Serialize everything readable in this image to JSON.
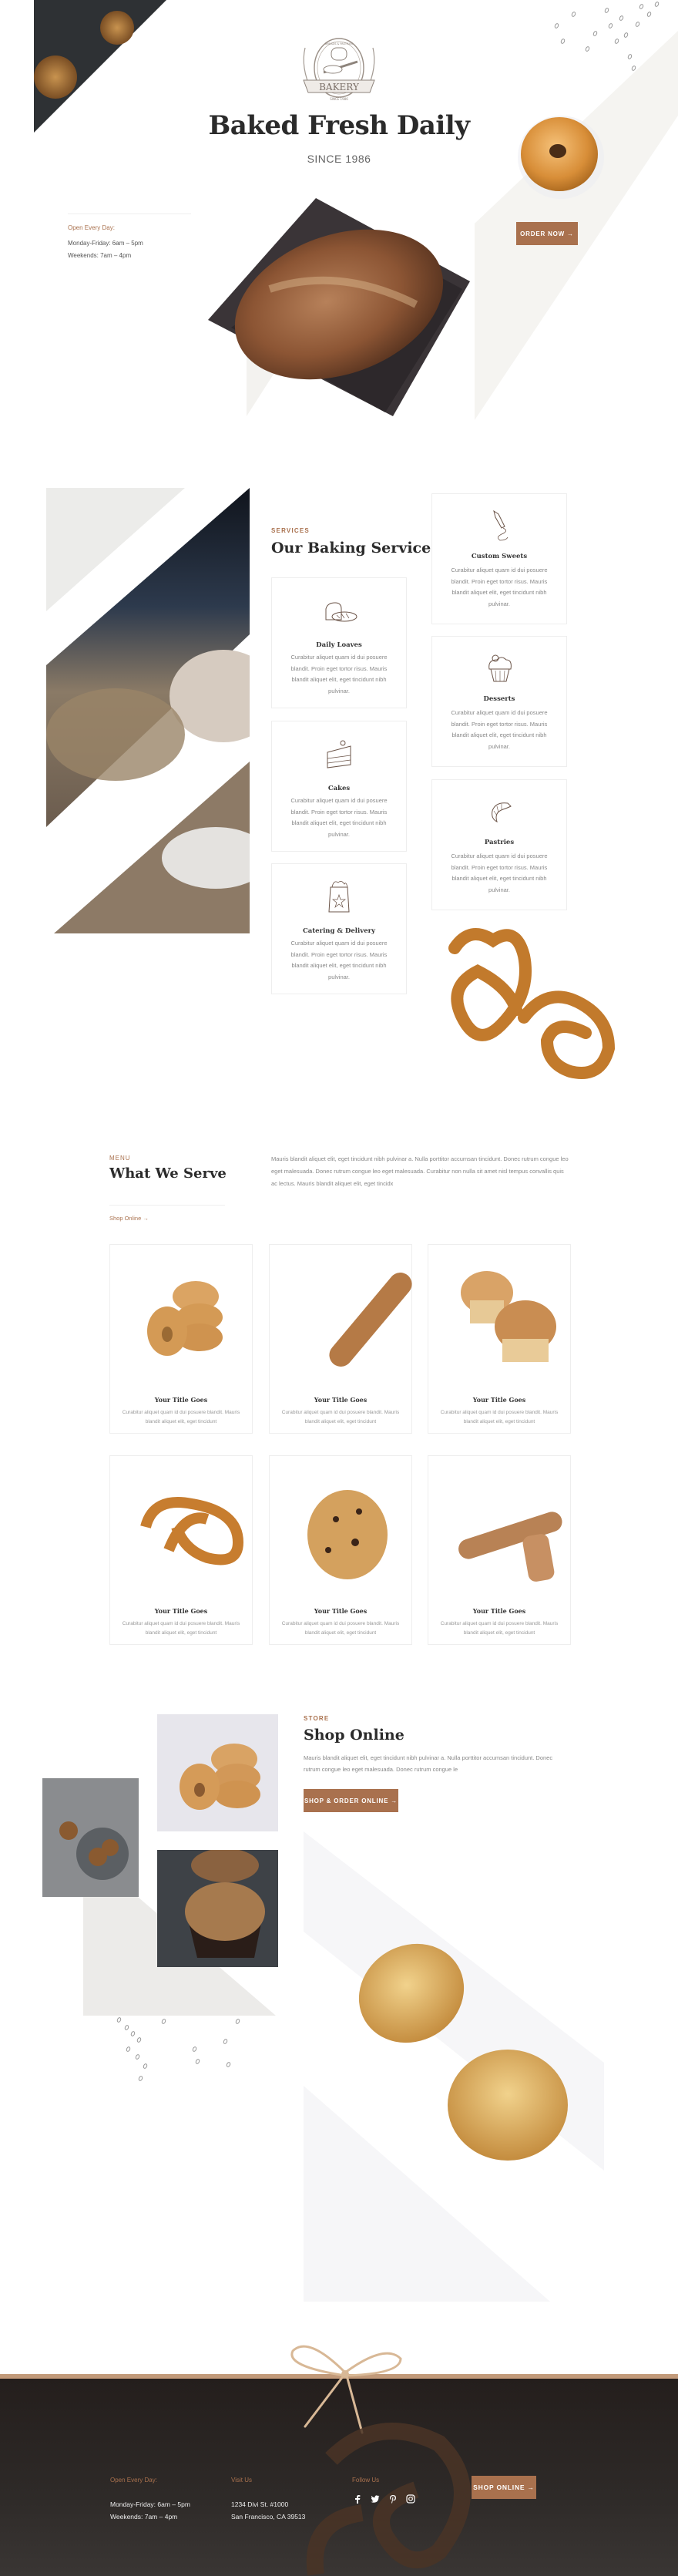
{
  "colors": {
    "accent": "#a9714e",
    "heading": "#2b2b2b",
    "body": "#888888",
    "light_panel": "#f5f4f1",
    "footer_bg": "#2a2624"
  },
  "hero": {
    "logo": {
      "name": "BAKERY",
      "arc_text": "BREADS & PASTRIES",
      "since": "SINCE 1986"
    },
    "title": "Baked Fresh Daily",
    "subtitle": "SINCE 1986",
    "hours": {
      "label": "Open Every Day:",
      "weekdays": "Monday-Friday: 6am – 5pm",
      "weekends": "Weekends: 7am – 4pm"
    },
    "order_button": "ORDER NOW →"
  },
  "services": {
    "eyebrow": "SERVICES",
    "title": "Our Baking Services",
    "items": [
      {
        "icon": "bread-loaf-icon",
        "title": "Daily Loaves",
        "desc": "Curabitur aliquet quam id dui posuere blandit. Proin eget tortor risus. Mauris blandit aliquet elit, eget tincidunt nibh pulvinar."
      },
      {
        "icon": "cake-slice-icon",
        "title": "Cakes",
        "desc": "Curabitur aliquet quam id dui posuere blandit. Proin eget tortor risus. Mauris blandit aliquet elit, eget tincidunt nibh pulvinar."
      },
      {
        "icon": "grocery-bag-icon",
        "title": "Catering & Delivery",
        "desc": "Curabitur aliquet quam id dui posuere blandit. Proin eget tortor risus. Mauris blandit aliquet elit, eget tincidunt nibh pulvinar."
      },
      {
        "icon": "piping-bag-icon",
        "title": "Custom Sweets",
        "desc": "Curabitur aliquet quam id dui posuere blandit. Proin eget tortor risus. Mauris blandit aliquet elit, eget tincidunt nibh pulvinar."
      },
      {
        "icon": "cupcake-icon",
        "title": "Desserts",
        "desc": "Curabitur aliquet quam id dui posuere blandit. Proin eget tortor risus. Mauris blandit aliquet elit, eget tincidunt nibh pulvinar."
      },
      {
        "icon": "croissant-icon",
        "title": "Pastries",
        "desc": "Curabitur aliquet quam id dui posuere blandit. Proin eget tortor risus. Mauris blandit aliquet elit, eget tincidunt nibh pulvinar."
      }
    ]
  },
  "menu": {
    "eyebrow": "MENU",
    "title": "What We Serve",
    "intro": "Mauris blandit aliquet elit, eget tincidunt nibh pulvinar a. Nulla porttitor accumsan tincidunt. Donec rutrum congue leo eget malesuada. Donec rutrum congue leo eget malesuada. Curabitur non nulla sit amet nisl tempus convallis quis ac lectus. Mauris blandit aliquet elit, eget tincidx",
    "link": "Shop Online →",
    "items": [
      {
        "image": "bagels",
        "title": "Your Title Goes",
        "desc": "Curabitur aliquet quam id dui posuere blandit. Mauris blandit aliquet elit, eget tincidunt"
      },
      {
        "image": "baguette",
        "title": "Your Title Goes",
        "desc": "Curabitur aliquet quam id dui posuere blandit. Mauris blandit aliquet elit, eget tincidunt"
      },
      {
        "image": "muffins",
        "title": "Your Title Goes",
        "desc": "Curabitur aliquet quam id dui posuere blandit. Mauris blandit aliquet elit, eget tincidunt"
      },
      {
        "image": "pretzel",
        "title": "Your Title Goes",
        "desc": "Curabitur aliquet quam id dui posuere blandit. Mauris blandit aliquet elit, eget tincidunt"
      },
      {
        "image": "cookie",
        "title": "Your Title Goes",
        "desc": "Curabitur aliquet quam id dui posuere blandit. Mauris blandit aliquet elit, eget tincidunt"
      },
      {
        "image": "breadsticks",
        "title": "Your Title Goes",
        "desc": "Curabitur aliquet quam id dui posuere blandit. Mauris blandit aliquet elit, eget tincidunt"
      }
    ]
  },
  "store": {
    "eyebrow": "STORE",
    "title": "Shop Online",
    "desc": "Mauris blandit aliquet elit, eget tincidunt nibh pulvinar a. Nulla porttitor accumsan tincidunt. Donec rutrum congue leo eget malesuada. Donec rutrum congue le",
    "button": "SHOP & ORDER ONLINE →"
  },
  "footer": {
    "hours": {
      "label": "Open Every Day:",
      "weekdays": "Monday-Friday: 6am – 5pm",
      "weekends": "Weekends: 7am – 4pm"
    },
    "visit": {
      "label": "Visit Us",
      "line1": "1234 Divi St. #1000",
      "line2": "San Francisco, CA 39513"
    },
    "follow": {
      "label": "Follow Us",
      "icons": [
        "facebook-icon",
        "twitter-icon",
        "pinterest-icon",
        "instagram-icon"
      ]
    },
    "button": "SHOP ONLINE →"
  }
}
